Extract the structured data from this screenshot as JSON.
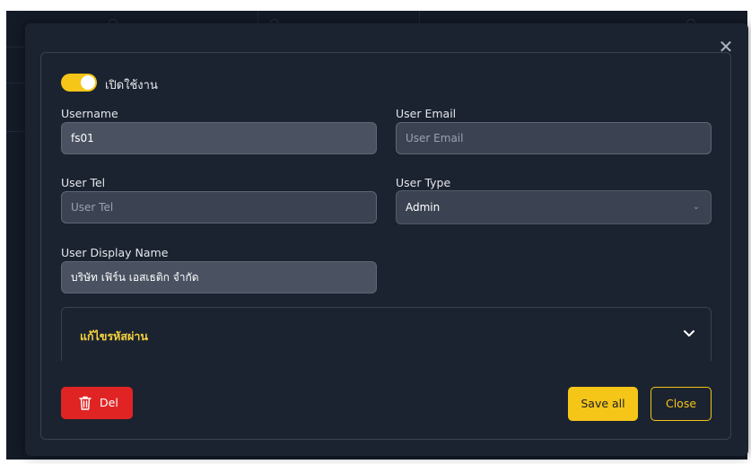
{
  "form": {
    "active_label": "เปิดใช้งาน",
    "active": true,
    "username_label": "Username",
    "username_value": "fs01",
    "email_label": "User Email",
    "email_placeholder": "User Email",
    "tel_label": "User Tel",
    "tel_placeholder": "User Tel",
    "type_label": "User Type",
    "type_value": "Admin",
    "display_name_label": "User Display Name",
    "display_name_value": "บริษัท เฟิร์น เอสเธติก จำกัด"
  },
  "password_section": {
    "title": "แก้ไขรหัสผ่าน"
  },
  "actions": {
    "delete_label": "Del",
    "save_label": "Save all",
    "close_label": "Close"
  },
  "colors": {
    "accent": "#f5c518",
    "danger": "#e02424",
    "modal_bg": "#1c2330"
  },
  "icons": {
    "modal_close": "close-icon",
    "section_toggle": "chevron-down-icon",
    "select_arrow": "chevron-down-icon",
    "delete": "trash-icon"
  }
}
